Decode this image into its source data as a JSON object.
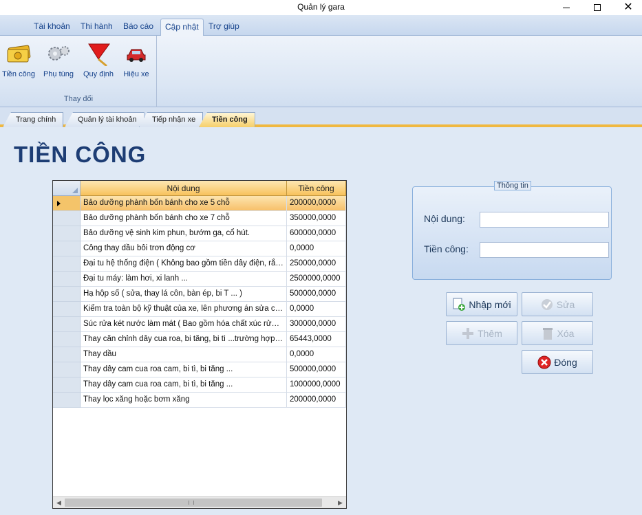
{
  "window": {
    "title": "Quản lý gara"
  },
  "ribbon": {
    "tabs": [
      {
        "label": "Tài khoản"
      },
      {
        "label": "Thi hành"
      },
      {
        "label": "Báo cáo"
      },
      {
        "label": "Cập nhật"
      },
      {
        "label": "Trợ giúp"
      }
    ],
    "active_tab": "Cập nhật",
    "group": {
      "caption": "Thay đổi",
      "buttons": [
        {
          "label": "Tiền công",
          "icon": "money-icon"
        },
        {
          "label": "Phụ tùng",
          "icon": "gears-icon"
        },
        {
          "label": "Quy định",
          "icon": "flag-icon"
        },
        {
          "label": "Hiệu xe",
          "icon": "car-icon"
        }
      ]
    }
  },
  "doc_tabs": [
    {
      "label": "Trang chính"
    },
    {
      "label": "Quản lý tài khoản"
    },
    {
      "label": "Tiếp nhận xe"
    },
    {
      "label": "Tiền công"
    }
  ],
  "active_doc_tab": "Tiền công",
  "page": {
    "title": "TIỀN CÔNG"
  },
  "grid": {
    "columns": [
      "Nội dung",
      "Tiền công"
    ],
    "rows": [
      [
        "Bảo dưỡng phành bốn bánh cho xe 5 chỗ",
        "200000,0000"
      ],
      [
        "Bảo dưỡng phành bốn bánh cho xe 7 chỗ",
        "350000,0000"
      ],
      [
        "Bảo dưỡng vệ sinh kim phun, bướm ga, cổ hút.",
        "600000,0000"
      ],
      [
        "Công thay dầu bôi trơn động cơ",
        "0,0000"
      ],
      [
        "Đại tu hệ thống điện ( Không bao gồm tiền dây điện, rắc cắm...",
        "250000,0000"
      ],
      [
        "Đại tu máy: làm hơi, xi lanh ...",
        "2500000,0000"
      ],
      [
        "Hạ hộp số ( sửa, thay lá côn, bàn ép, bi T ... )",
        "500000,0000"
      ],
      [
        "Kiểm tra toàn bộ kỹ thuật của xe, lên phương án sửa chữa",
        "0,0000"
      ],
      [
        "Súc rửa két nước làm mát ( Bao gồm hóa chất xúc rửa và hóa chất...",
        "300000,0000"
      ],
      [
        "Thay căn chỉnh dây cua roa, bi tăng, bi tì ...trường hợp đã biết",
        "65443,0000"
      ],
      [
        "Thay dầu",
        "0,0000"
      ],
      [
        "Thay dây cam cua roa cam, bi tì, bi tăng ...",
        "500000,0000"
      ],
      [
        "Thay dây cam cua roa cam, bi tì, bi tăng ...",
        "1000000,0000"
      ],
      [
        "Thay lọc xăng hoặc bơm xăng",
        "200000,0000"
      ]
    ],
    "selected_row": 0
  },
  "info": {
    "legend": "Thông tin",
    "content_label": "Nội dung:",
    "content_value": "",
    "fee_label": "Tiền công:",
    "fee_value": ""
  },
  "buttons": {
    "new": "Nhập mới",
    "edit": "Sửa",
    "add": "Thêm",
    "delete": "Xóa",
    "close": "Đóng"
  },
  "colors": {
    "accent": "#f0b840",
    "title": "#1d3d74",
    "background": "#dfe9f5"
  }
}
